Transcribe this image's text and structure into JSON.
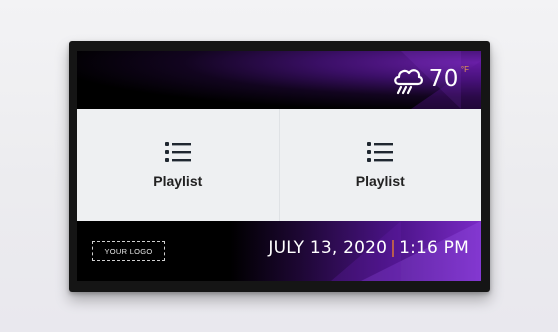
{
  "weather": {
    "icon": "rain-cloud-icon",
    "temperature": "70",
    "unit": "°F"
  },
  "tiles": [
    {
      "icon": "list-icon",
      "label": "Playlist"
    },
    {
      "icon": "list-icon",
      "label": "Playlist"
    }
  ],
  "footer": {
    "logo_text": "YOUR LOGO",
    "date": "JULY 13, 2020",
    "separator": "|",
    "time": "1:16 PM"
  },
  "colors": {
    "accent_purple": "#7a2bc6",
    "separator_orange": "#e07a35",
    "unit_orange": "#e79a55"
  }
}
